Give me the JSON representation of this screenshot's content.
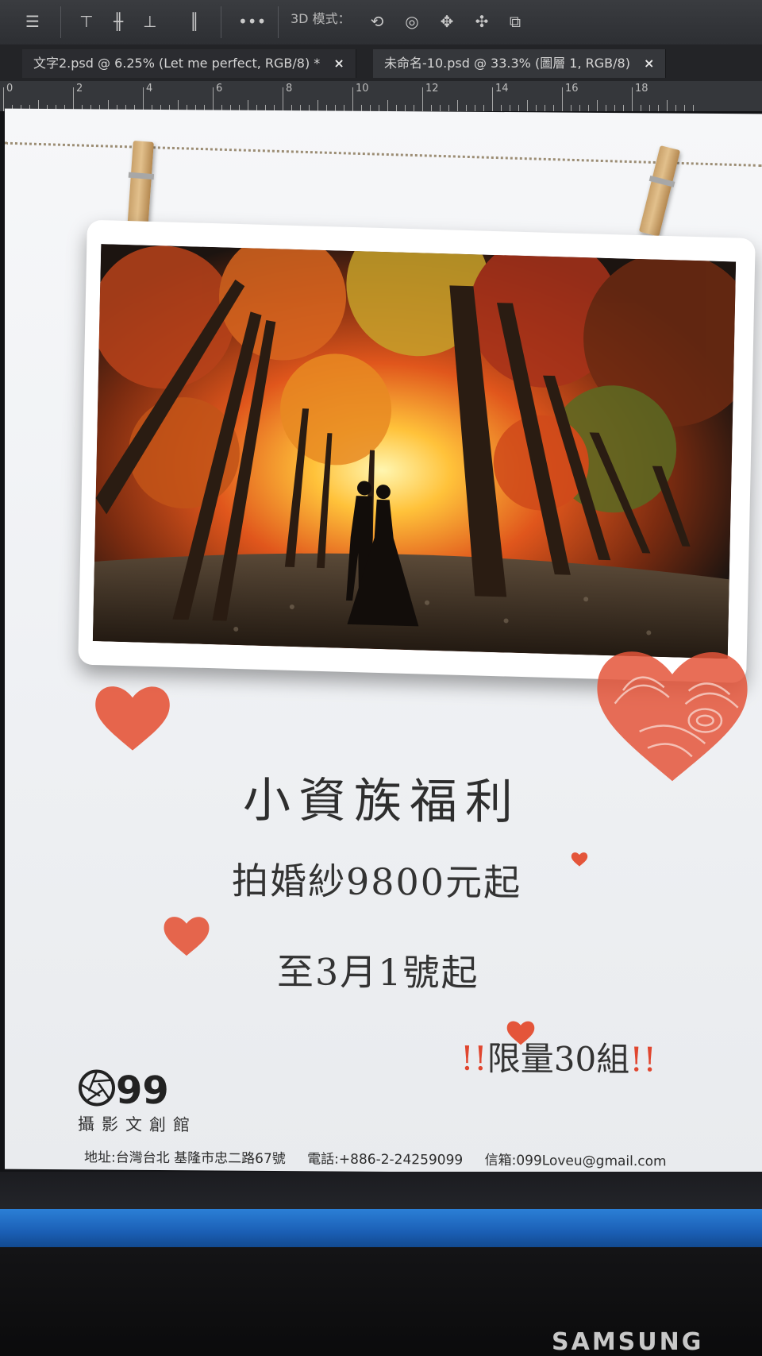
{
  "optionsbar": {
    "label_3d": "3D 模式：",
    "icons": [
      "align-top-icon",
      "align-vcenter-icon",
      "align-bottom-icon",
      "distribute-icon",
      "more-icon",
      "orbit-3d-icon",
      "roll-3d-icon",
      "pan-3d-icon",
      "slide-3d-icon",
      "scale-3d-icon"
    ]
  },
  "tabs": [
    {
      "label": "文字2.psd @ 6.25% (Let me perfect, RGB/8) *",
      "close": "×"
    },
    {
      "label": "未命名-10.psd @ 33.3% (圖層 1, RGB/8)",
      "close": "×"
    }
  ],
  "ruler": {
    "labels": [
      "0",
      "2",
      "4",
      "6",
      "8",
      "10",
      "12",
      "14",
      "16",
      "18"
    ]
  },
  "poster": {
    "headline": "小資族福利",
    "price": "拍婚紗9800元起",
    "date": "至3月1號起",
    "limit_prefix": "!!",
    "limit_text": "限量30組",
    "limit_suffix": "!!",
    "logo_number": "99",
    "logo_subtitle": "攝影文創館",
    "address": "地址:台灣台北 基隆市忠二路67號",
    "phone": "電話:+886-2-24259099",
    "email": "信箱:099Loveu@gmail.com"
  },
  "colors": {
    "heart": "#e4553a",
    "accent_bang": "#e0462f",
    "blue_strip": "#1b5fb5"
  },
  "monitor": {
    "brand": "SAMSUNG"
  }
}
